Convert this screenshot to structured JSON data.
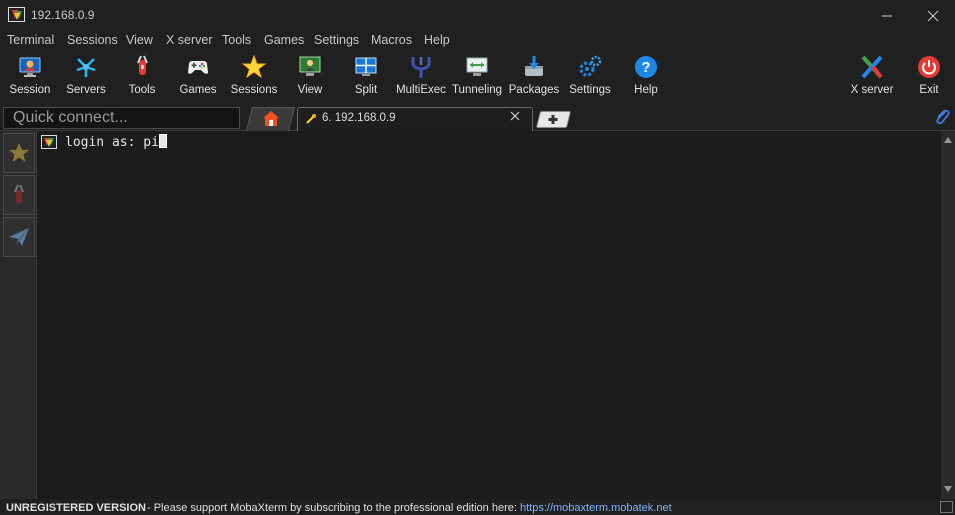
{
  "window": {
    "title": "192.168.0.9",
    "controls": {
      "minimize": "minimize",
      "maximize": "maximize",
      "close": "close"
    }
  },
  "menu": [
    "Terminal",
    "Sessions",
    "View",
    "X server",
    "Tools",
    "Games",
    "Settings",
    "Macros",
    "Help"
  ],
  "toolbar": {
    "session": "Session",
    "servers": "Servers",
    "tools": "Tools",
    "games": "Games",
    "sessions": "Sessions",
    "view": "View",
    "split": "Split",
    "multiexec": "MultiExec",
    "tunneling": "Tunneling",
    "packages": "Packages",
    "settings": "Settings",
    "help": "Help",
    "xserver": "X server",
    "exit": "Exit"
  },
  "quick_connect": {
    "placeholder": "Quick connect..."
  },
  "tabs": {
    "active_label": "6. 192.168.0.9"
  },
  "terminal": {
    "prompt": "login as: ",
    "input": "pi"
  },
  "status": {
    "unregistered": "UNREGISTERED VERSION",
    "message": "-  Please support MobaXterm by subscribing to the professional edition here:",
    "link": "https://mobaxterm.mobatek.net"
  },
  "colors": {
    "background": "#1e1e1e",
    "bar": "#202020",
    "link": "#7db6ff",
    "exit_red": "#e53935",
    "help_blue": "#1e88e5"
  }
}
